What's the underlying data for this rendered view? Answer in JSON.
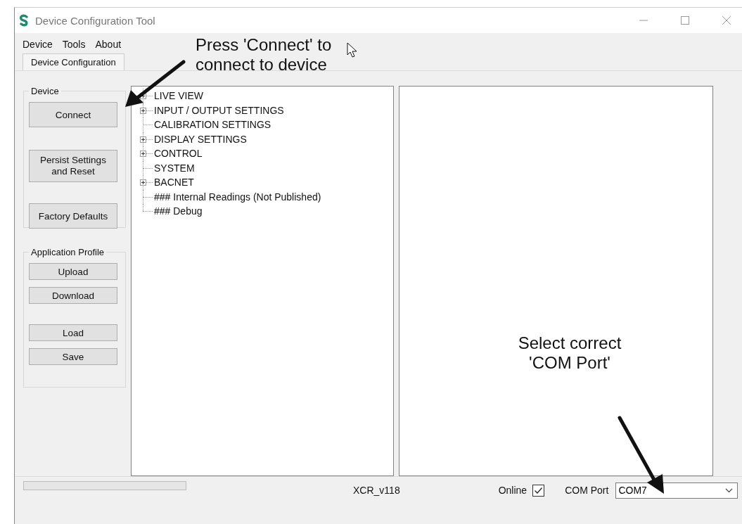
{
  "window": {
    "title": "Device Configuration Tool"
  },
  "menu": [
    "Device",
    "Tools",
    "About"
  ],
  "tabs": [
    {
      "label": "Device Configuration",
      "selected": true
    }
  ],
  "device_group": {
    "title": "Device",
    "buttons": [
      "Connect",
      "Persist Settings and Reset",
      "Factory Defaults"
    ]
  },
  "profile_group": {
    "title": "Application Profile",
    "buttons": [
      "Upload",
      "Download",
      "Load",
      "Save"
    ]
  },
  "tree": [
    {
      "label": "LIVE VIEW",
      "expandable": true
    },
    {
      "label": "INPUT / OUTPUT SETTINGS",
      "expandable": true
    },
    {
      "label": "CALIBRATION SETTINGS",
      "expandable": false
    },
    {
      "label": "DISPLAY SETTINGS",
      "expandable": true
    },
    {
      "label": "CONTROL",
      "expandable": true
    },
    {
      "label": "SYSTEM",
      "expandable": false
    },
    {
      "label": "BACNET",
      "expandable": true
    },
    {
      "label": "### Internal Readings (Not Published)",
      "expandable": false
    },
    {
      "label": "### Debug",
      "expandable": false
    }
  ],
  "status_bar": {
    "progress": {
      "level": 0
    },
    "version": "XCR_v118",
    "online_label": "Online",
    "online_checked": true,
    "port_label": "COM Port",
    "port_value": "COM7"
  },
  "annotations": [
    {
      "text": "Press 'Connect' to connect to device"
    },
    {
      "text": "Select correct 'COM Port'"
    }
  ]
}
